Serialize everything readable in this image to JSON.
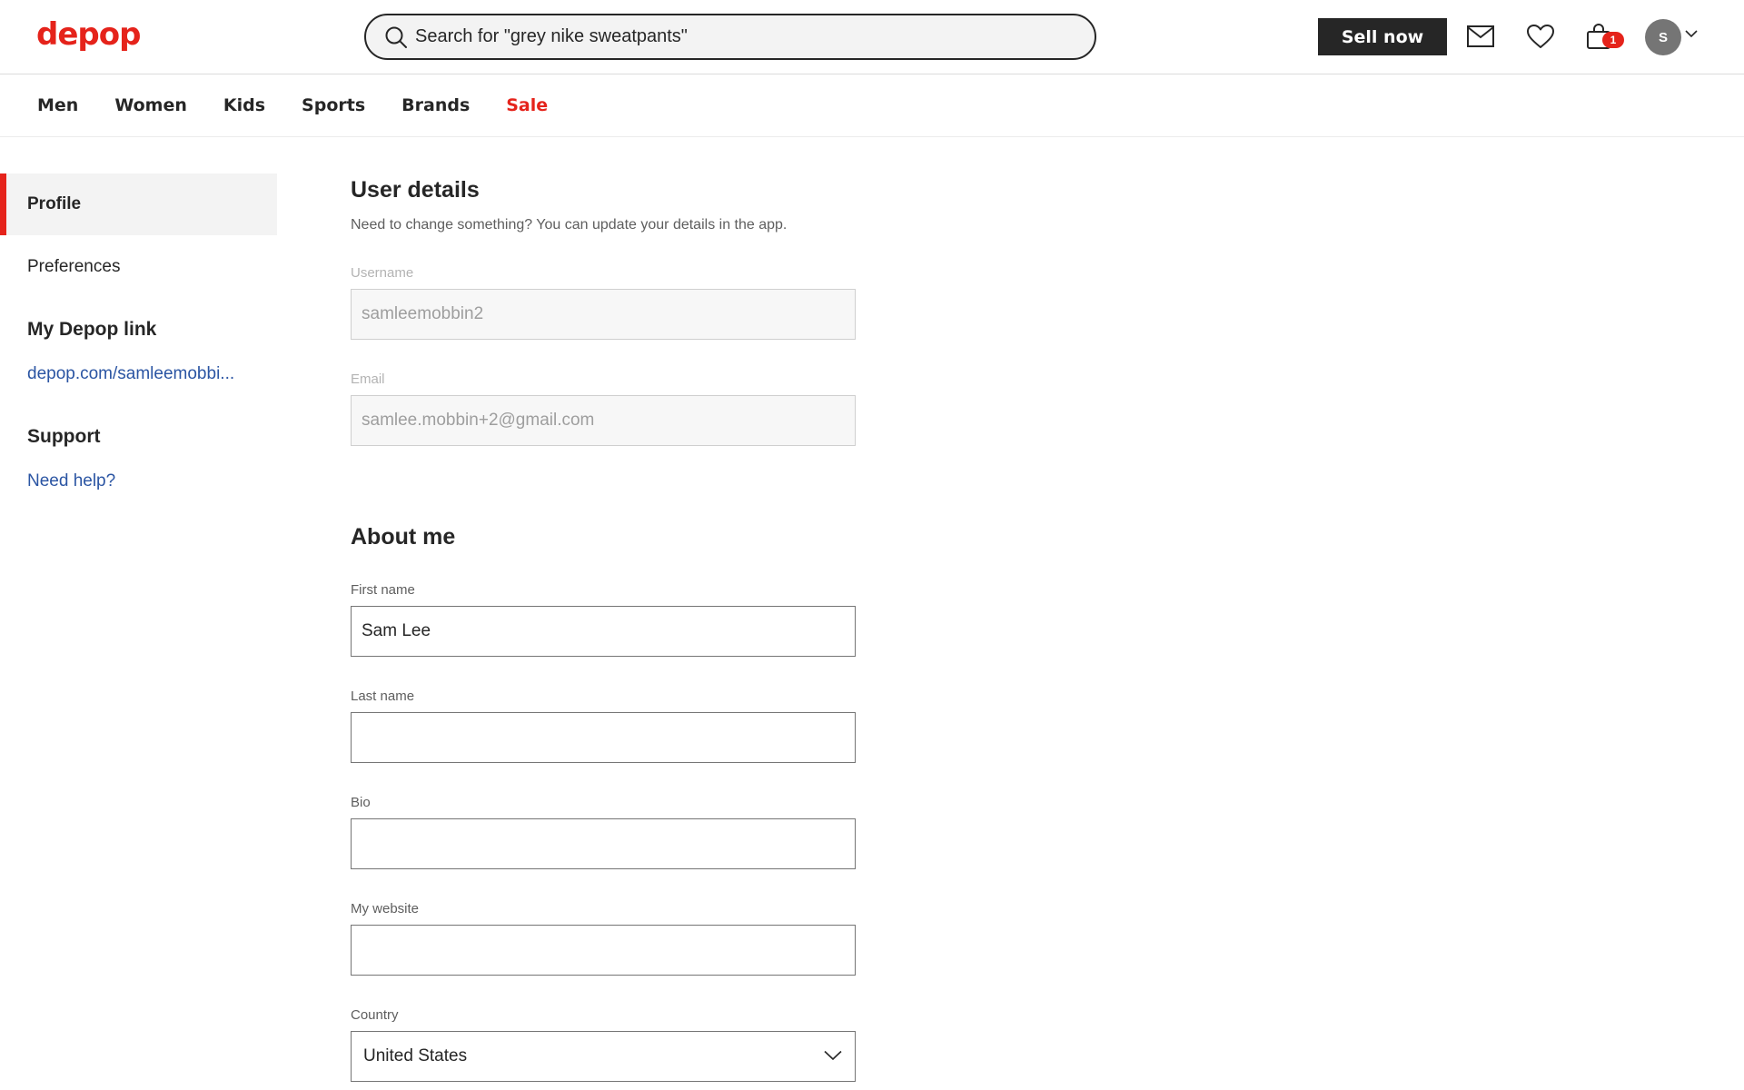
{
  "brand": {
    "logo": "depop",
    "logo_color": "#e5231b"
  },
  "search": {
    "value": "Search for \"grey nike sweatpants\""
  },
  "header": {
    "sell_label": "Sell now",
    "cart_count": "1",
    "avatar_initial": "S"
  },
  "nav": {
    "items": [
      "Men",
      "Women",
      "Kids",
      "Sports",
      "Brands",
      "Sale"
    ]
  },
  "sidebar": {
    "profile": "Profile",
    "preferences": "Preferences",
    "link_heading": "My Depop link",
    "link": "depop.com/samleemobbi...",
    "support_heading": "Support",
    "help": "Need help?"
  },
  "user_details": {
    "title": "User details",
    "subtitle": "Need to change something? You can update your details in the app.",
    "username_label": "Username",
    "username_value": "samleemobbin2",
    "email_label": "Email",
    "email_value": "samlee.mobbin+2@gmail.com"
  },
  "about": {
    "title": "About me",
    "first_name_label": "First name",
    "first_name_value": "Sam Lee",
    "last_name_label": "Last name",
    "last_name_value": "",
    "bio_label": "Bio",
    "bio_value": "",
    "website_label": "My website",
    "website_value": "",
    "country_label": "Country",
    "country_value": "United States"
  },
  "colors": {
    "accent": "#e5231b",
    "link": "#2b55a3",
    "dark": "#262626"
  }
}
